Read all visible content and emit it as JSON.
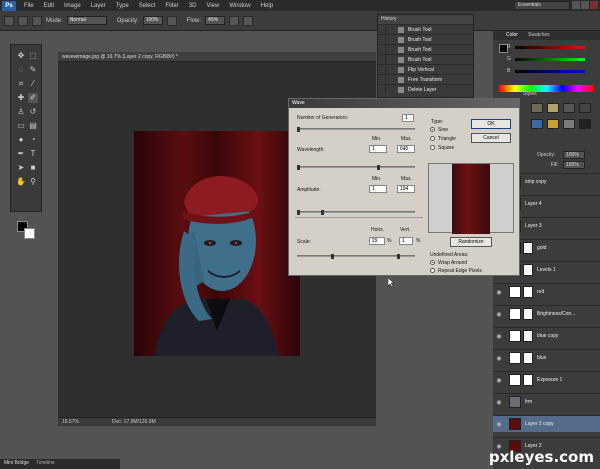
{
  "app": {
    "logo": "Ps",
    "menu": [
      "File",
      "Edit",
      "Image",
      "Layer",
      "Type",
      "Select",
      "Filter",
      "3D",
      "View",
      "Window",
      "Help"
    ],
    "workspace": "Essentials"
  },
  "options_bar": {
    "mode_label": "Mode:",
    "mode_value": "Normal",
    "opacity_label": "Opacity:",
    "opacity_value": "100%",
    "flow_label": "Flow:",
    "flow_value": "45%"
  },
  "document": {
    "tab_title": "wavewimage.jpg @ 16.7% (Layer 2 copy, RGB/8#) *",
    "zoom": "16.67%",
    "doc_info": "Doc: 17.9M/126.9M"
  },
  "history": {
    "title": "History",
    "items": [
      "Brush Tool",
      "Brush Tool",
      "Brush Tool",
      "Brush Tool",
      "Flip Vertical",
      "Free Transform",
      "Delete Layer"
    ]
  },
  "color_panel": {
    "tabs": [
      "Color",
      "Swatches"
    ],
    "slider_labels": [
      "R",
      "G",
      "B"
    ]
  },
  "styles_panel": {
    "title": "Styles"
  },
  "layers_panel": {
    "opacity_label": "Opacity:",
    "opacity_value": "100%",
    "fill_label": "Fill:",
    "fill_value": "100%",
    "layers": [
      {
        "name": "strip copy",
        "thumb": "#3a3a3a",
        "mask": false,
        "selected": false
      },
      {
        "name": "Layer 4",
        "thumb": "#3a3a3a",
        "mask": false,
        "selected": false
      },
      {
        "name": "Layer 3",
        "thumb": "#3a3a3a",
        "mask": false,
        "selected": false
      },
      {
        "name": "gold",
        "thumb": "#000000",
        "mask": true,
        "selected": false
      },
      {
        "name": "Levels 1",
        "thumb": "#ffffff",
        "mask": true,
        "selected": false
      },
      {
        "name": "red",
        "thumb": "#ffffff",
        "mask": true,
        "selected": false
      },
      {
        "name": "Brightness/Con...",
        "thumb": "#ffffff",
        "mask": true,
        "selected": false
      },
      {
        "name": "blue copy",
        "thumb": "#ffffff",
        "mask": true,
        "selected": false
      },
      {
        "name": "blue",
        "thumb": "#ffffff",
        "mask": true,
        "selected": false
      },
      {
        "name": "Exposure 1",
        "thumb": "#ffffff",
        "mask": true,
        "selected": false
      },
      {
        "name": "frm",
        "thumb": "#6c6c78",
        "mask": false,
        "selected": false
      },
      {
        "name": "Layer 2 copy",
        "thumb": "#5a0c0c",
        "mask": false,
        "selected": true
      },
      {
        "name": "Layer 2",
        "thumb": "#5a0c0c",
        "mask": false,
        "selected": false
      }
    ]
  },
  "wave_dialog": {
    "title": "Wave",
    "generators_label": "Number of Generators:",
    "generators_value": "1",
    "wavelength_label": "Wavelength:",
    "wavelength_min": "1",
    "wavelength_max": "645",
    "amplitude_label": "Amplitude:",
    "amplitude_min": "1",
    "amplitude_max": "194",
    "scale_label": "Scale:",
    "scale_horiz": "29",
    "scale_vert": "1",
    "min_label": "Min.",
    "max_label": "Max.",
    "horiz_label": "Horiz.",
    "vert_label": "Vert.",
    "percent": "%",
    "type_label": "Type:",
    "type_options": [
      "Sine",
      "Triangle",
      "Square"
    ],
    "type_selected": "Sine",
    "ok_label": "OK",
    "cancel_label": "Cancel",
    "randomize_label": "Randomize",
    "undefined_label": "Undefined Areas:",
    "undefined_options": [
      "Wrap Around",
      "Repeat Edge Pixels"
    ],
    "undefined_selected": "Wrap Around"
  },
  "bottom_tabs": [
    "Mini Bridge",
    "Timeline"
  ],
  "watermark": "pxleyes.com"
}
